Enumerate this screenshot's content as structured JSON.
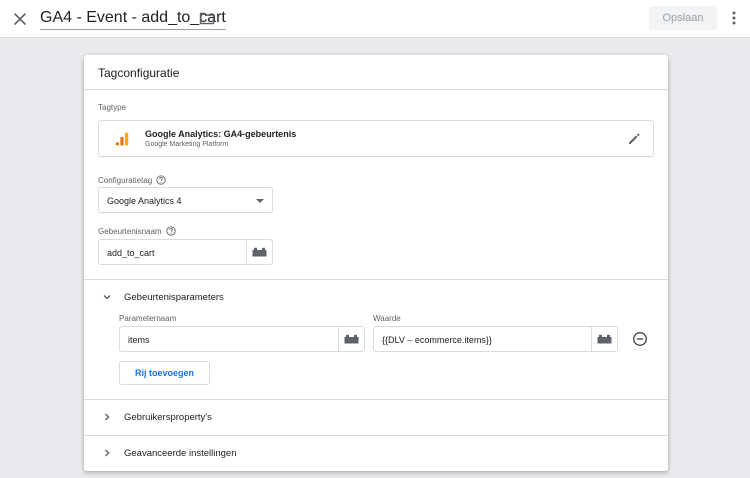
{
  "header": {
    "tag_title": "GA4 - Event - add_to_cart",
    "save_label": "Opslaan"
  },
  "card": {
    "title": "Tagconfiguratie",
    "tagtype": {
      "label": "Tagtype",
      "name": "Google Analytics: GA4-gebeurtenis",
      "platform": "Google Marketing Platform"
    },
    "config_tag": {
      "label": "Configuratietag",
      "value": "Google Analytics 4"
    },
    "event_name": {
      "label": "Gebeurtenisnaam",
      "value": "add_to_cart"
    },
    "event_params": {
      "title": "Gebeurtenisparameters",
      "name_label": "Parameternaam",
      "value_label": "Waarde",
      "rows": [
        {
          "name": "items",
          "value": "{{DLV – ecommerce.items}}"
        }
      ],
      "add_row_label": "Rij toevoegen"
    },
    "user_properties": {
      "title": "Gebruikersproperty's"
    },
    "advanced": {
      "title": "Geavanceerde instellingen"
    }
  },
  "colors": {
    "accent": "#1a73e8",
    "ga_orange": "#f9ab00",
    "ga_dark_orange": "#e37400"
  }
}
